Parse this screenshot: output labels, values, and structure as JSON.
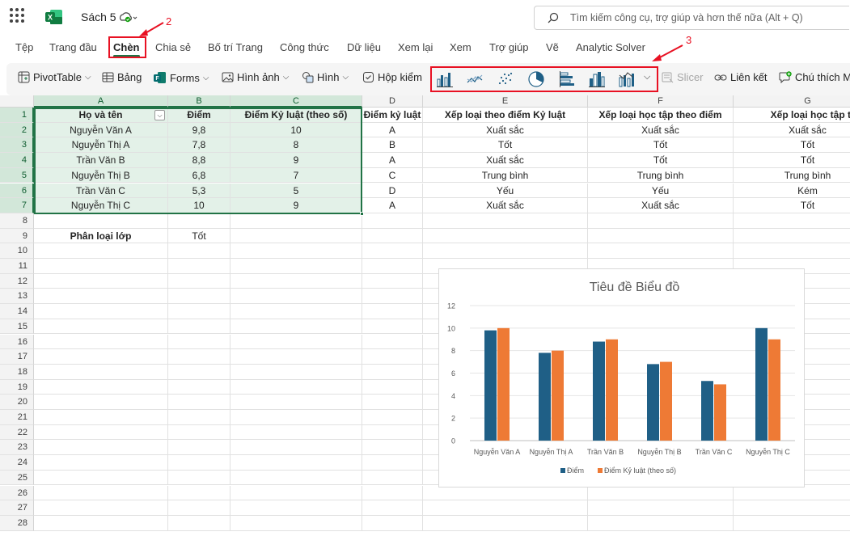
{
  "titlebar": {
    "title": "Sách 5",
    "status": "⌕ ⌄",
    "search_placeholder": "Tìm kiếm công cụ, trợ giúp và hơn thế nữa (Alt + Q)"
  },
  "tabs": [
    {
      "label": "Tệp"
    },
    {
      "label": "Trang đầu"
    },
    {
      "label": "Chèn"
    },
    {
      "label": "Chia sẻ"
    },
    {
      "label": "Bố trí Trang"
    },
    {
      "label": "Công thức"
    },
    {
      "label": "Dữ liệu"
    },
    {
      "label": "Xem lại"
    },
    {
      "label": "Xem"
    },
    {
      "label": "Trợ giúp"
    },
    {
      "label": "Vẽ"
    },
    {
      "label": "Analytic Solver"
    }
  ],
  "ribbon": {
    "pivottable": "PivotTable",
    "table": "Bảng",
    "forms": "Forms",
    "picture": "Hình ảnh",
    "shapes": "Hình",
    "checkbox": "Hộp kiểm",
    "slicer": "Slicer",
    "link": "Liên kết",
    "comment": "Chú thích M",
    "chart_icons": [
      "column-chart-icon",
      "line-chart-icon",
      "scatter-chart-icon",
      "pie-chart-icon",
      "bar-chart-icon",
      "clustered-column-icon",
      "combo-chart-icon"
    ]
  },
  "annotations": {
    "a2": "2",
    "a3": "3"
  },
  "columns": [
    "A",
    "B",
    "C",
    "D",
    "E",
    "F",
    "G"
  ],
  "rows": [
    "1",
    "2",
    "3",
    "4",
    "5",
    "6",
    "7",
    "8",
    "9",
    "10",
    "11",
    "12",
    "13",
    "14",
    "15",
    "16",
    "17",
    "18",
    "19",
    "20",
    "21",
    "22",
    "23",
    "24",
    "25",
    "26",
    "27",
    "28"
  ],
  "header": {
    "a": "Họ và tên",
    "b": "Điểm",
    "c": "Điểm Kỷ luật (theo số)",
    "d": "Điểm kỷ luật",
    "e": "Xếp loại theo điểm Kỷ luật",
    "f": "Xếp loại học tập theo điểm",
    "g": "Xếp loại học tập theo đ"
  },
  "table": [
    {
      "a": "Nguyễn Văn A",
      "b": "9,8",
      "c": "10",
      "d": "A",
      "e": "Xuất sắc",
      "f": "Xuất sắc",
      "g": "Xuất sắc"
    },
    {
      "a": "Nguyễn Thị A",
      "b": "7,8",
      "c": "8",
      "d": "B",
      "e": "Tốt",
      "f": "Tốt",
      "g": "Tốt"
    },
    {
      "a": "Trần Văn B",
      "b": "8,8",
      "c": "9",
      "d": "A",
      "e": "Xuất sắc",
      "f": "Tốt",
      "g": "Tốt"
    },
    {
      "a": "Nguyễn Thị B",
      "b": "6,8",
      "c": "7",
      "d": "C",
      "e": "Trung bình",
      "f": "Trung bình",
      "g": "Trung bình"
    },
    {
      "a": "Trần Văn C",
      "b": "5,3",
      "c": "5",
      "d": "D",
      "e": "Yếu",
      "f": "Yếu",
      "g": "Kém"
    },
    {
      "a": "Nguyễn Thị C",
      "b": "10",
      "c": "9",
      "d": "A",
      "e": "Xuất sắc",
      "f": "Xuất sắc",
      "g": "Tốt"
    }
  ],
  "row9": {
    "a": "Phân loại lớp",
    "b": "Tốt"
  },
  "colors": {
    "series1": "#1f5f86",
    "series2": "#ee7a35",
    "accent": "#217346",
    "annotation": "#e81123"
  },
  "chart_data": {
    "type": "bar",
    "title": "Tiêu đề Biểu đồ",
    "categories": [
      "Nguyễn Văn A",
      "Nguyễn Thị A",
      "Trần Văn B",
      "Nguyễn Thị B",
      "Trần Văn C",
      "Nguyễn Thị C"
    ],
    "series": [
      {
        "name": "Điểm",
        "values": [
          9.8,
          7.8,
          8.8,
          6.8,
          5.3,
          10
        ]
      },
      {
        "name": "Điểm Kỷ luật (theo số)",
        "values": [
          10,
          8,
          9,
          7,
          5,
          9
        ]
      }
    ],
    "ylim": [
      0,
      12
    ],
    "yticks": [
      "0",
      "2",
      "4",
      "6",
      "8",
      "10",
      "12"
    ],
    "grid": true,
    "legend": "bottom"
  }
}
